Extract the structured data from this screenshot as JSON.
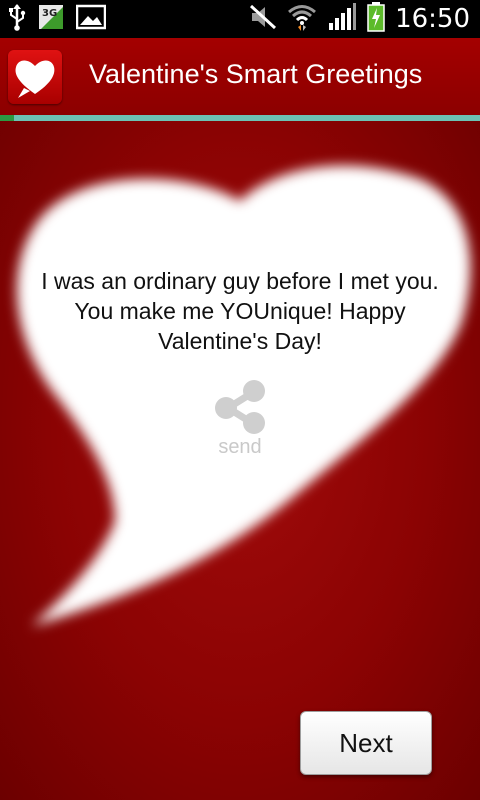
{
  "status_bar": {
    "time": "16:50",
    "network_label": "3G",
    "icons": [
      "usb-icon",
      "3g-icon",
      "image-icon",
      "mute-icon",
      "wifi-icon",
      "signal-icon",
      "battery-charging-icon"
    ]
  },
  "app": {
    "title": "Valentine's Smart Greetings",
    "icon": "speech-heart-icon"
  },
  "greeting": {
    "message": "I was an ordinary guy before I met you. You make me YOUnique! Happy Valentine's Day!"
  },
  "share": {
    "label": "send",
    "icon": "share-icon"
  },
  "navigation": {
    "next_label": "Next"
  },
  "colors": {
    "background": "#8e0000",
    "accent_bar": "#6cc2b4",
    "accent_bar_start": "#2c9a43",
    "bubble": "#ffffff"
  }
}
